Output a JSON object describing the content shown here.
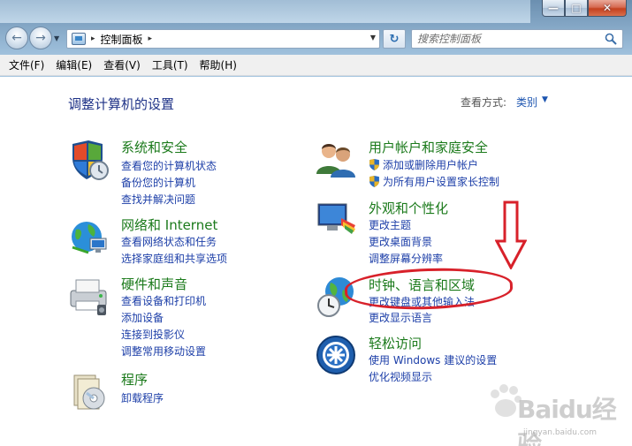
{
  "window": {
    "caption_buttons": [
      "minimize",
      "maximize",
      "close"
    ]
  },
  "nav": {
    "back_icon": "back-arrow-icon",
    "forward_icon": "forward-arrow-icon",
    "address": {
      "separator_1": "▸",
      "path": "控制面板",
      "separator_2": "▸"
    },
    "search": {
      "placeholder": "搜索控制面板"
    }
  },
  "menu": {
    "items": [
      "文件(F)",
      "编辑(E)",
      "查看(V)",
      "工具(T)",
      "帮助(H)"
    ]
  },
  "main": {
    "title": "调整计算机的设置",
    "view_by_label": "查看方式:",
    "view_by_value": "类别",
    "categories": [
      {
        "icon": "system-security-icon",
        "title": "系统和安全",
        "links": [
          "查看您的计算机状态",
          "备份您的计算机",
          "查找并解决问题"
        ]
      },
      {
        "icon": "network-internet-icon",
        "title": "网络和 Internet",
        "links": [
          "查看网络状态和任务",
          "选择家庭组和共享选项"
        ]
      },
      {
        "icon": "hardware-sound-icon",
        "title": "硬件和声音",
        "links": [
          "查看设备和打印机",
          "添加设备",
          "连接到投影仪",
          "调整常用移动设置"
        ]
      },
      {
        "icon": "programs-icon",
        "title": "程序",
        "links": [
          "卸载程序"
        ]
      },
      {
        "icon": "user-accounts-icon",
        "title": "用户帐户和家庭安全",
        "links": [
          "添加或删除用户帐户",
          "为所有用户设置家长控制"
        ]
      },
      {
        "icon": "appearance-icon",
        "title": "外观和个性化",
        "links": [
          "更改主题",
          "更改桌面背景",
          "调整屏幕分辨率"
        ]
      },
      {
        "icon": "clock-language-region-icon",
        "title": "时钟、语言和区域",
        "links": [
          "更改键盘或其他输入法",
          "更改显示语言"
        ]
      },
      {
        "icon": "ease-of-access-icon",
        "title": "轻松访问",
        "links": [
          "使用 Windows 建议的设置",
          "优化视频显示"
        ]
      }
    ]
  },
  "annotation": {
    "color": "#d8212a"
  },
  "watermark": {
    "brand": "Baidu经验",
    "url": "jingyan.baidu.com"
  }
}
